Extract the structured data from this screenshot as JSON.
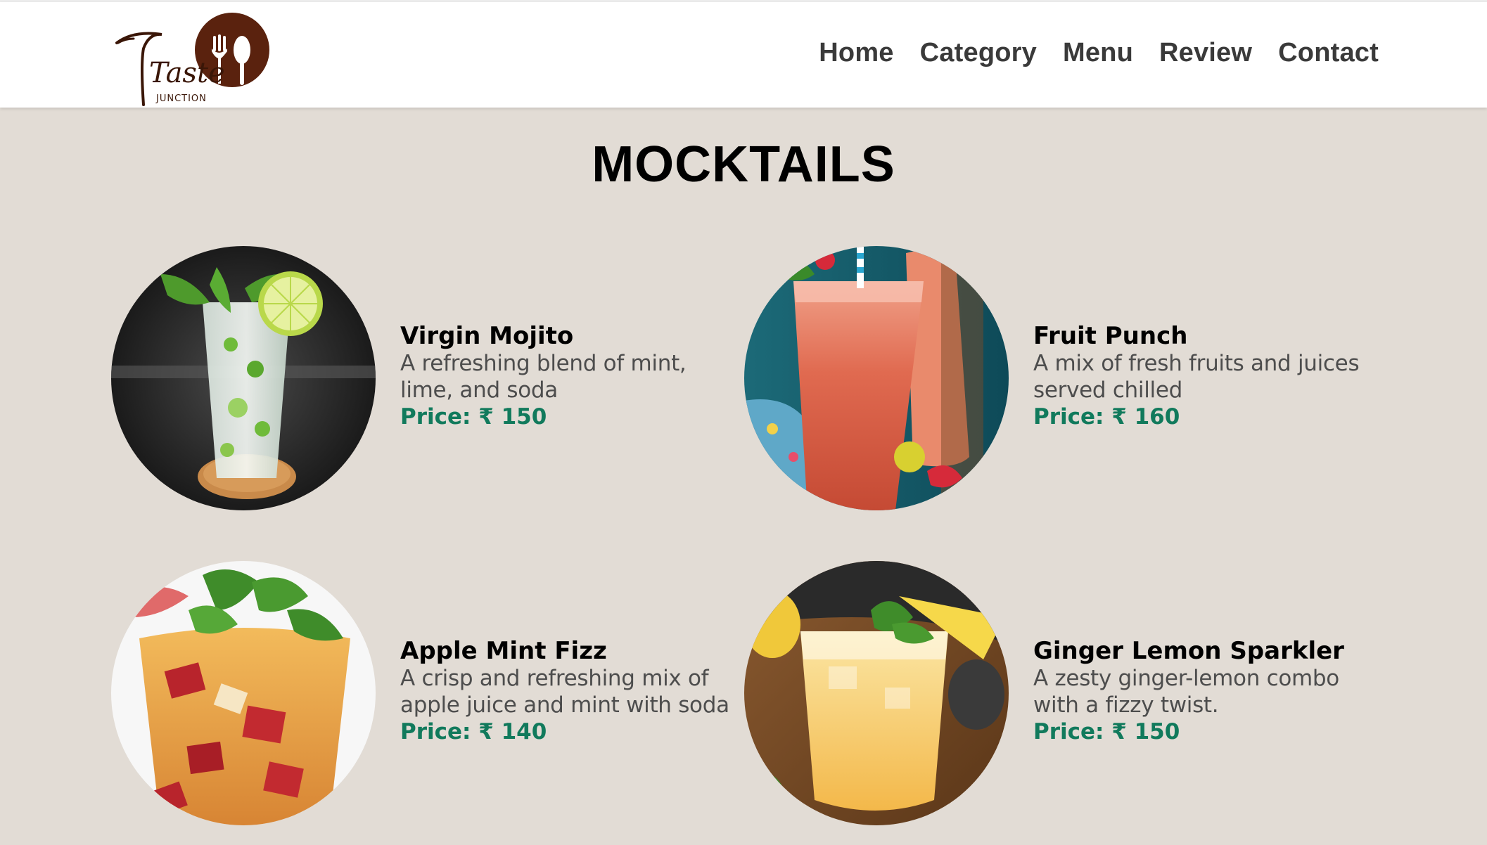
{
  "brand": {
    "logo_text": "Taste",
    "logo_subtext": "JUNCTION",
    "color": "#5a220e"
  },
  "nav": {
    "items": [
      "Home",
      "Category",
      "Menu",
      "Review",
      "Contact"
    ]
  },
  "page": {
    "title": "MOCKTAILS"
  },
  "price_color": "#117a5c",
  "menu_items": [
    {
      "name": "Virgin Mojito",
      "description": "A refreshing blend of mint, lime, and soda",
      "price_label": "Price: ₹ 150",
      "image": "virgin-mojito-photo"
    },
    {
      "name": "Fruit Punch",
      "description": "A mix of fresh fruits and juices served chilled",
      "price_label": "Price: ₹ 160",
      "image": "fruit-punch-photo"
    },
    {
      "name": "Apple Mint Fizz",
      "description": "A crisp and refreshing mix of apple juice and mint with soda",
      "price_label": "Price: ₹ 140",
      "image": "apple-mint-fizz-photo"
    },
    {
      "name": "Ginger Lemon Sparkler",
      "description": "A zesty ginger-lemon combo with a fizzy twist.",
      "price_label": "Price: ₹ 150",
      "image": "ginger-lemon-sparkler-photo"
    }
  ]
}
